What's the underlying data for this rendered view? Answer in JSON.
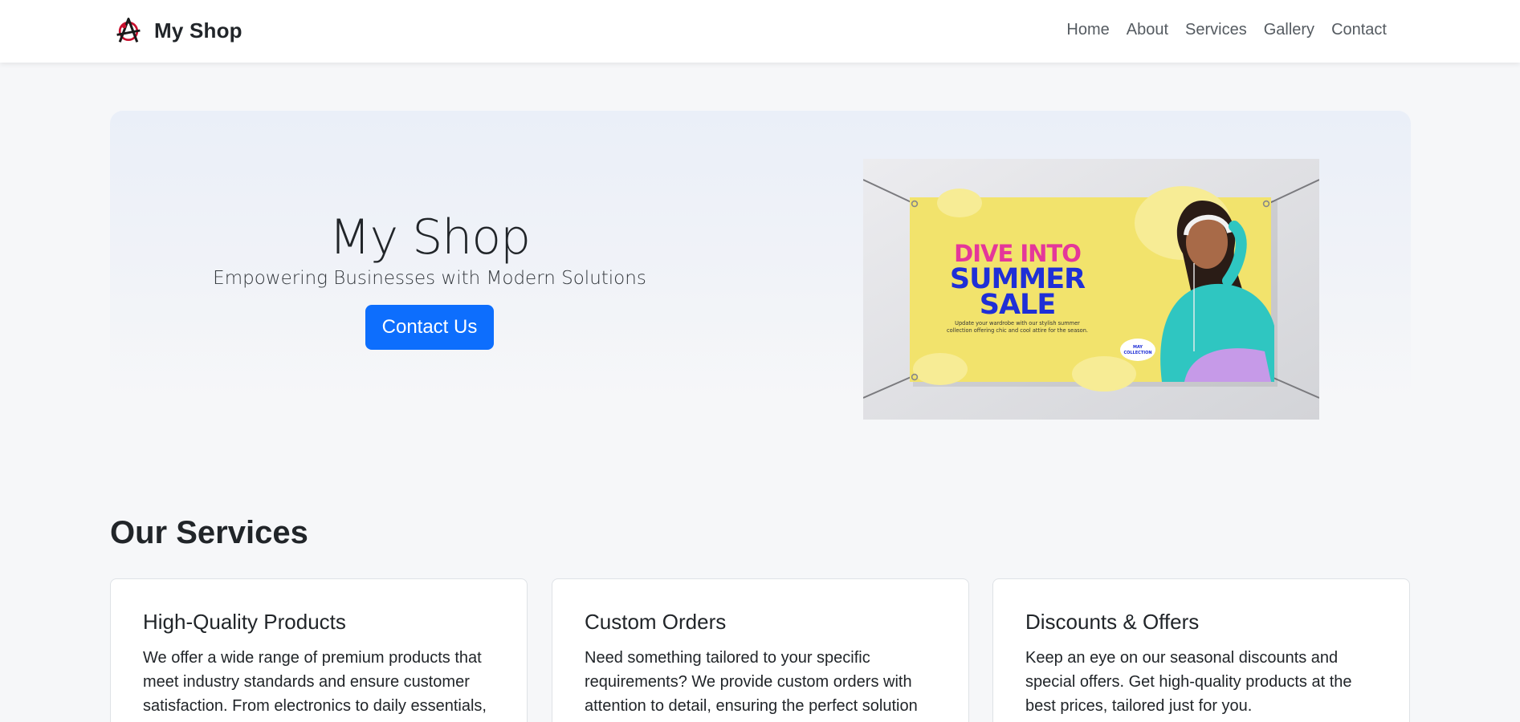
{
  "navbar": {
    "brand": "My Shop",
    "links": [
      "Home",
      "About",
      "Services",
      "Gallery",
      "Contact"
    ]
  },
  "hero": {
    "title": "My Shop",
    "subtitle": "Empowering Businesses with Modern Solutions",
    "cta_label": "Contact Us",
    "banner": {
      "line1": "DIVE INTO",
      "line2": "SUMMER",
      "line3": "SALE",
      "body_line1": "Update your wardrobe with our stylish summer",
      "body_line2": "collection offering chic and cool attire for the season.",
      "badge_line1": "MAY",
      "badge_line2": "COLLECTION"
    }
  },
  "services": {
    "title": "Our Services",
    "cards": [
      {
        "title": "High-Quality Products",
        "text": "We offer a wide range of premium products that meet industry standards and ensure customer satisfaction. From electronics to daily essentials,"
      },
      {
        "title": "Custom Orders",
        "text": "Need something tailored to your specific requirements? We provide custom orders with attention to detail, ensuring the perfect solution"
      },
      {
        "title": "Discounts & Offers",
        "text": "Keep an eye on our seasonal discounts and special offers. Get high-quality products at the best prices, tailored just for you."
      }
    ]
  },
  "colors": {
    "primary": "#0d6efd",
    "banner_yellow": "#f2e36c",
    "banner_pink": "#e4379a",
    "banner_blue": "#1f2fd6",
    "logo_red": "#c8102e"
  }
}
